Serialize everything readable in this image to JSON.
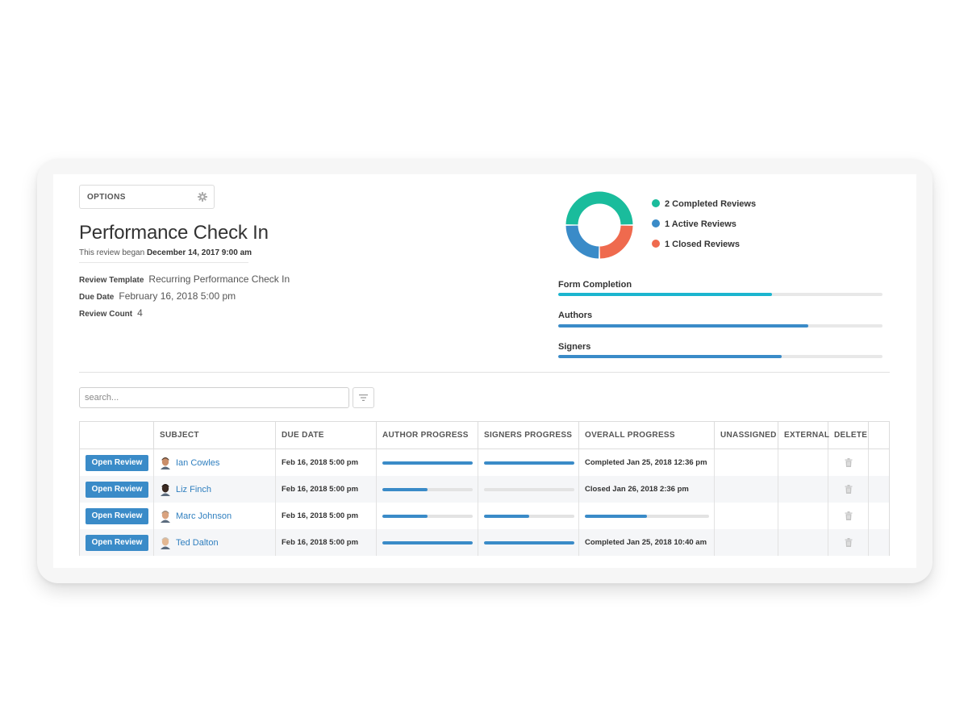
{
  "colors": {
    "completed": "#1abc9c",
    "active": "#3a8bc8",
    "closed": "#ef6a4e",
    "form_completion": "#1bb5cf",
    "primary": "#3a8bc8"
  },
  "header": {
    "options_label": "OPTIONS",
    "options_icon": "gear-icon",
    "title": "Performance Check In",
    "began_prefix": "This review began",
    "began_date": "December 14, 2017 9:00 am"
  },
  "meta": {
    "template_label": "Review Template",
    "template_value": "Recurring Performance Check In",
    "due_label": "Due Date",
    "due_value": "February 16, 2018 5:00 pm",
    "count_label": "Review Count",
    "count_value": "4"
  },
  "summary": {
    "completed_count": 2,
    "active_count": 1,
    "closed_count": 1,
    "legend": [
      {
        "label": "2 Completed Reviews",
        "color": "#1abc9c"
      },
      {
        "label": "1 Active Reviews",
        "color": "#3a8bc8"
      },
      {
        "label": "1 Closed Reviews",
        "color": "#ef6a4e"
      }
    ]
  },
  "progress": [
    {
      "label": "Form Completion",
      "value": 0.66,
      "color": "#1bb5cf"
    },
    {
      "label": "Authors",
      "value": 0.77,
      "color": "#3a8bc8"
    },
    {
      "label": "Signers",
      "value": 0.69,
      "color": "#3a8bc8"
    }
  ],
  "search": {
    "placeholder": "search...",
    "filter_icon": "filter-icon"
  },
  "table": {
    "columns": [
      "",
      "SUBJECT",
      "DUE DATE",
      "AUTHOR PROGRESS",
      "SIGNERS PROGRESS",
      "OVERALL PROGRESS",
      "UNASSIGNED",
      "EXTERNAL",
      "DELETE",
      ""
    ],
    "open_label": "Open Review",
    "rows": [
      {
        "subject": "Ian Cowles",
        "due": "Feb 16, 2018 5:00 pm",
        "author": 1.0,
        "signers": 1.0,
        "overall_text": "Completed Jan 25, 2018 12:36 pm"
      },
      {
        "subject": "Liz Finch",
        "due": "Feb 16, 2018 5:00 pm",
        "author": 0.5,
        "signers": 0.0,
        "overall_text": "Closed Jan 26, 2018 2:36 pm"
      },
      {
        "subject": "Marc Johnson",
        "due": "Feb 16, 2018 5:00 pm",
        "author": 0.5,
        "signers": 0.5,
        "overall_text": "",
        "overall_value": 0.5
      },
      {
        "subject": "Ted Dalton",
        "due": "Feb 16, 2018 5:00 pm",
        "author": 1.0,
        "signers": 1.0,
        "overall_text": "Completed Jan 25, 2018 10:40 am"
      }
    ]
  }
}
